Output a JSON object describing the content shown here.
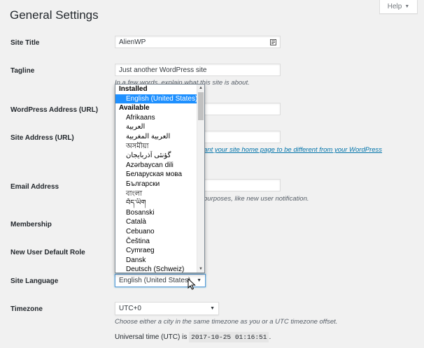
{
  "page": {
    "title": "General Settings"
  },
  "help": {
    "label": "Help",
    "caret": "▼"
  },
  "fields": {
    "site_title": {
      "label": "Site Title",
      "value": "AlienWP"
    },
    "tagline": {
      "label": "Tagline",
      "value": "Just another WordPress site",
      "description": "In a few words, explain what this site is about."
    },
    "wordpress_address": {
      "label": "WordPress Address (URL)"
    },
    "site_address": {
      "label": "Site Address (URL)",
      "link_text": "ant your site home page to be different from your WordPress"
    },
    "email": {
      "label": "Email Address",
      "description": "purposes, like new user notification."
    },
    "membership": {
      "label": "Membership"
    },
    "default_role": {
      "label": "New User Default Role"
    },
    "site_language": {
      "label": "Site Language",
      "selected": "English (United States)"
    },
    "timezone": {
      "label": "Timezone",
      "selected": "UTC+0",
      "description": "Choose either a city in the same timezone as you or a UTC timezone offset.",
      "utc_prefix": "Universal time (UTC) is",
      "utc_time": "2017-10-25 01:16:51",
      "utc_suffix": "."
    }
  },
  "language_dropdown": {
    "installed_label": "Installed",
    "installed": [
      "English (United States)"
    ],
    "available_label": "Available",
    "available": [
      "Afrikaans",
      "العربية",
      "العربية المغربية",
      "অসমীয়া",
      "گؤنئی آذربایجان",
      "Azərbaycan dili",
      "Беларуская мова",
      "Български",
      "বাংলা",
      "བོད་ཡིག",
      "Bosanski",
      "Català",
      "Cebuano",
      "Čeština",
      "Cymraeg",
      "Dansk",
      "Deutsch (Schweiz)"
    ]
  },
  "icons": {
    "field_icon": "contact-card-icon",
    "scroll_up": "▲",
    "scroll_down": "▼",
    "select_caret": "▼"
  }
}
